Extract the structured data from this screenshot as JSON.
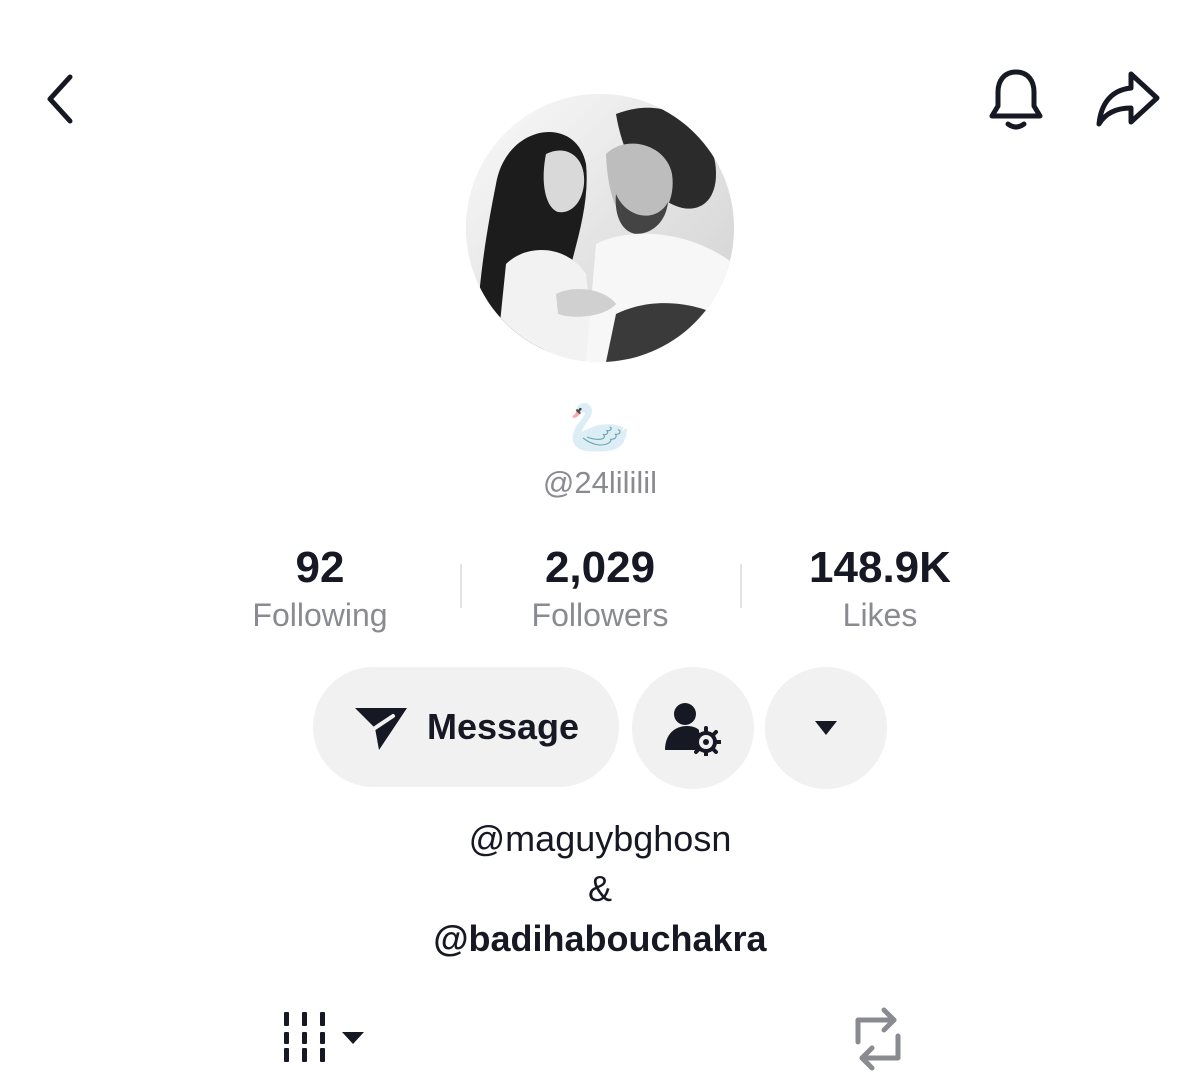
{
  "header": {
    "back_icon": "chevron-left-icon",
    "notification_icon": "bell-icon",
    "share_icon": "share-arrow-icon"
  },
  "profile": {
    "nickname": "🦢",
    "username": "@24lililil"
  },
  "stats": {
    "following_count": "92",
    "following_label": "Following",
    "followers_count": "2,029",
    "followers_label": "Followers",
    "likes_count": "148.9K",
    "likes_label": "Likes"
  },
  "actions": {
    "message_label": "Message",
    "message_icon": "paper-plane-icon",
    "manage_icon": "user-gear-icon",
    "more_icon": "caret-down-icon"
  },
  "bio": {
    "line1": "@maguybghosn",
    "line2": "&",
    "line3": "@badihabouchakra"
  },
  "tabs": {
    "videos_icon": "grid-columns-icon",
    "reposts_icon": "repost-icon"
  },
  "colors": {
    "text_primary": "#161823",
    "text_secondary": "#8a8b91",
    "button_bg": "#f1f1f2",
    "background": "#ffffff"
  }
}
